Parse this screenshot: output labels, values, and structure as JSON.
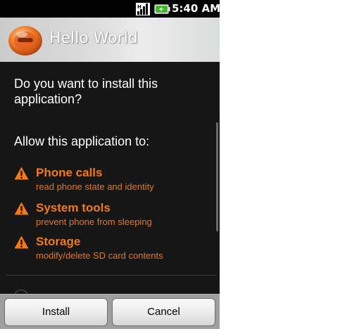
{
  "status_bar": {
    "time": "5:40 AM",
    "icons": [
      "signal-icon",
      "battery-charging-icon"
    ]
  },
  "title_bar": {
    "app_name": "Hello World",
    "app_icon": "app-icon"
  },
  "content": {
    "question": "Do you want to install this application?",
    "allow_heading": "Allow this application to:",
    "permissions": [
      {
        "title": "Phone calls",
        "description": "read phone state and identity",
        "icon": "warning-icon"
      },
      {
        "title": "System tools",
        "description": "prevent phone from sleeping",
        "icon": "warning-icon"
      },
      {
        "title": "Storage",
        "description": "modify/delete SD card contents",
        "icon": "warning-icon"
      }
    ]
  },
  "buttons": {
    "install": "Install",
    "cancel": "Cancel"
  },
  "colors": {
    "permission_accent": "#f27a19",
    "background": "#161616",
    "button_bar": "#9f9f9f"
  }
}
